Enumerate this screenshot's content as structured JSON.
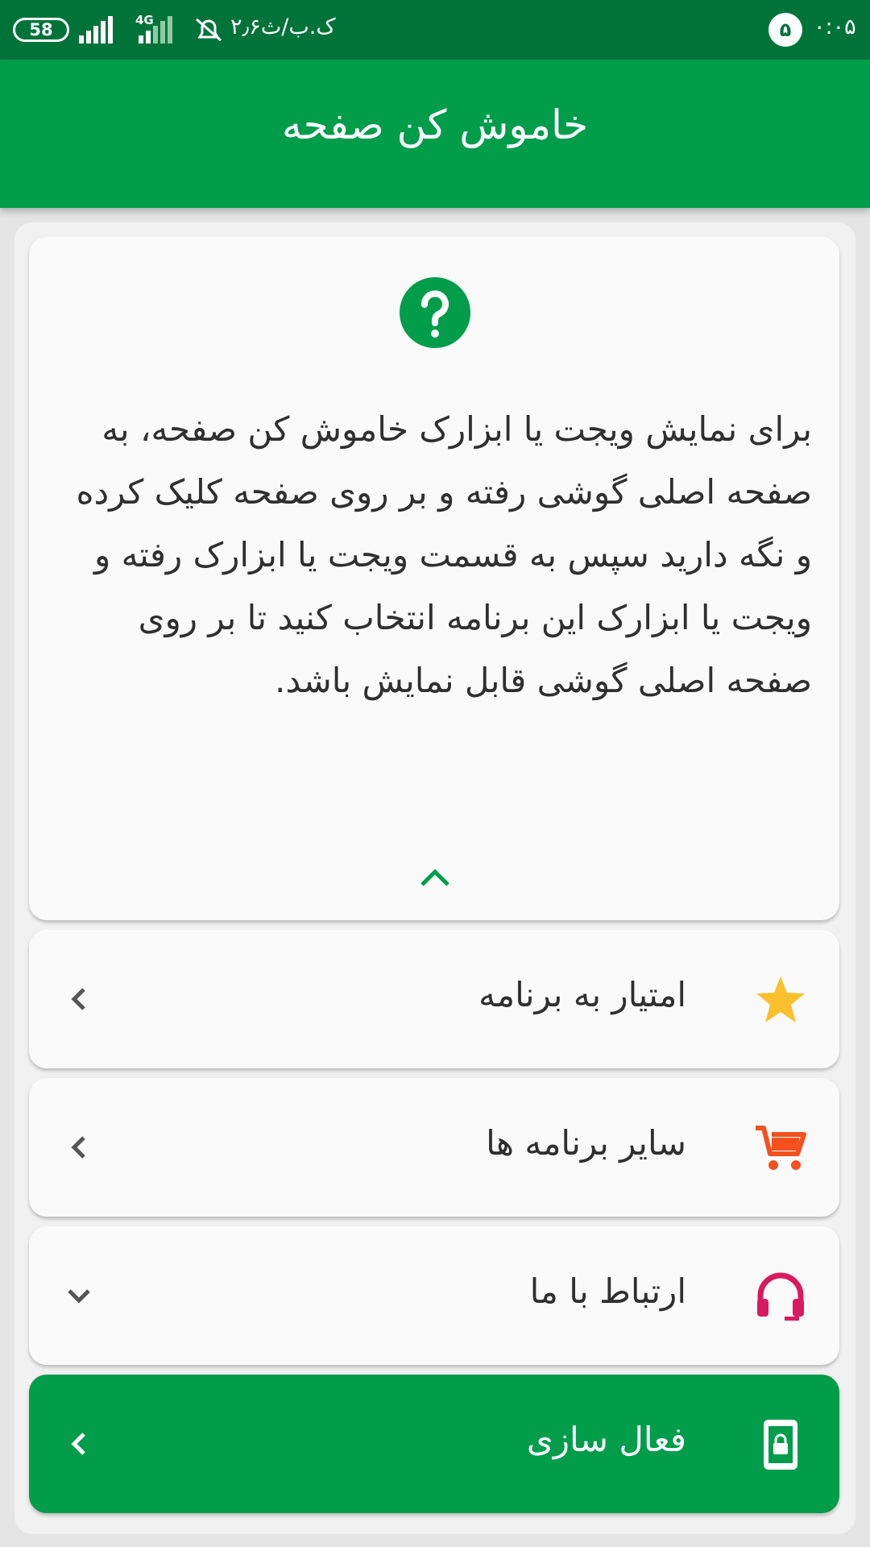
{
  "status_bar": {
    "battery": "58",
    "network": "4G",
    "time_left": "۲٫۶ک.ب/ث",
    "notification_count": "۵",
    "clock": "۰:۰۵"
  },
  "app_bar": {
    "title": "خاموش کن صفحه"
  },
  "info_card": {
    "icon": "question-circle-icon",
    "text": "برای نمایش ویجت یا ابزارک خاموش کن صفحه، به صفحه اصلی گوشی رفته و بر روی صفحه کلیک کرده و نگه دارید سپس به قسمت ویجت یا ابزارک رفته و ویجت یا ابزارک این برنامه انتخاب کنید تا بر روی صفحه اصلی گوشی قابل نمایش باشد.",
    "collapse_icon": "chevron-up-icon"
  },
  "menu": {
    "rate": {
      "label": "امتیار به برنامه",
      "icon": "star-icon",
      "icon_color": "#fbc02d"
    },
    "other_apps": {
      "label": "سایر برنامه ها",
      "icon": "cart-icon",
      "icon_color": "#f4511e"
    },
    "contact": {
      "label": "ارتباط با ما",
      "icon": "headset-icon",
      "icon_color": "#d81b60"
    },
    "activate": {
      "label": "فعال سازی",
      "icon": "phone-lock-icon",
      "background": "#019d4b"
    }
  },
  "colors": {
    "primary": "#019d4b",
    "primary_dark": "#00733a"
  }
}
